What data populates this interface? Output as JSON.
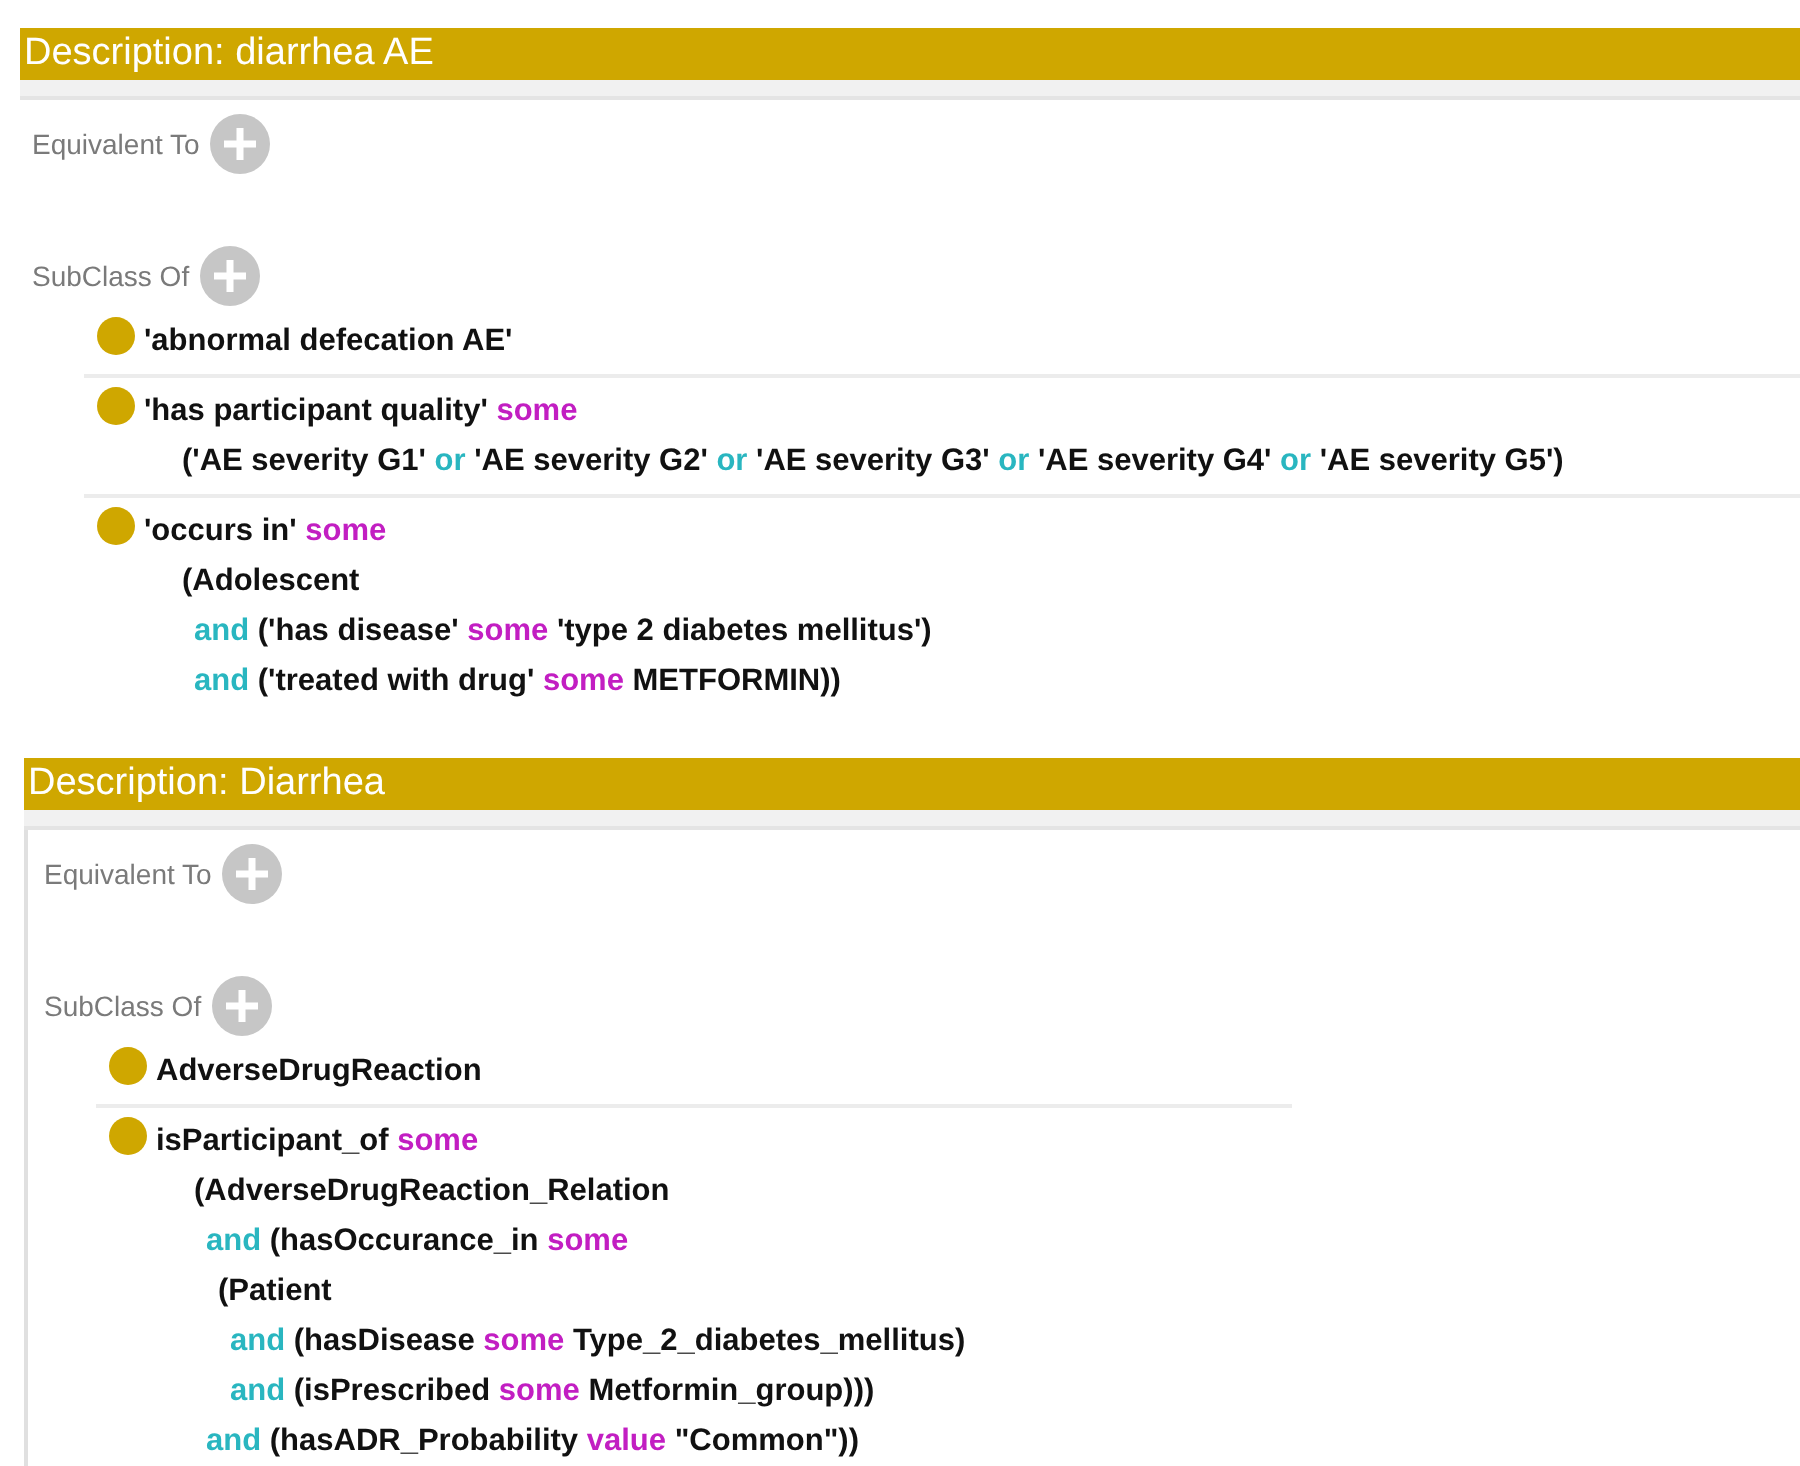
{
  "panels": [
    {
      "title": "Description: diarrhea AE",
      "sections": [
        {
          "label": "Equivalent To"
        },
        {
          "label": "SubClass Of",
          "items": [
            {
              "lines": [
                {
                  "tokens": [
                    {
                      "kind": "entity",
                      "text": "'abnormal defecation AE'"
                    }
                  ]
                }
              ]
            },
            {
              "lines": [
                {
                  "tokens": [
                    {
                      "kind": "entity",
                      "text": "'has participant quality'"
                    },
                    {
                      "kind": "restriction",
                      "text": "some"
                    }
                  ],
                  "children": [
                    {
                      "tokens": [
                        {
                          "kind": "entity",
                          "text": "('AE severity G1'"
                        },
                        {
                          "kind": "connective",
                          "text": "or"
                        },
                        {
                          "kind": "entity",
                          "text": "'AE severity G2'"
                        },
                        {
                          "kind": "connective",
                          "text": "or"
                        },
                        {
                          "kind": "entity",
                          "text": "'AE severity G3'"
                        },
                        {
                          "kind": "connective",
                          "text": "or"
                        },
                        {
                          "kind": "entity",
                          "text": "'AE severity G4'"
                        },
                        {
                          "kind": "connective",
                          "text": "or"
                        },
                        {
                          "kind": "entity",
                          "text": "'AE severity G5')"
                        }
                      ]
                    }
                  ]
                }
              ]
            },
            {
              "lines": [
                {
                  "tokens": [
                    {
                      "kind": "entity",
                      "text": "'occurs in'"
                    },
                    {
                      "kind": "restriction",
                      "text": "some"
                    }
                  ],
                  "children": [
                    {
                      "tokens": [
                        {
                          "kind": "entity",
                          "text": "(Adolescent"
                        }
                      ],
                      "children": [
                        {
                          "tokens": [
                            {
                              "kind": "connective",
                              "text": "and"
                            },
                            {
                              "kind": "entity",
                              "text": "('has disease'"
                            },
                            {
                              "kind": "restriction",
                              "text": "some"
                            },
                            {
                              "kind": "entity",
                              "text": "'type 2 diabetes mellitus')"
                            }
                          ]
                        },
                        {
                          "tokens": [
                            {
                              "kind": "connective",
                              "text": "and"
                            },
                            {
                              "kind": "entity",
                              "text": "('treated with drug'"
                            },
                            {
                              "kind": "restriction",
                              "text": "some"
                            },
                            {
                              "kind": "entity",
                              "text": "METFORMIN))"
                            }
                          ]
                        }
                      ]
                    }
                  ]
                }
              ]
            }
          ]
        }
      ]
    },
    {
      "title": "Description: Diarrhea",
      "sections": [
        {
          "label": "Equivalent To"
        },
        {
          "label": "SubClass Of",
          "items": [
            {
              "lines": [
                {
                  "tokens": [
                    {
                      "kind": "entity",
                      "text": "AdverseDrugReaction"
                    }
                  ]
                }
              ]
            },
            {
              "lines": [
                {
                  "tokens": [
                    {
                      "kind": "entity",
                      "text": "isParticipant_of"
                    },
                    {
                      "kind": "restriction",
                      "text": "some"
                    }
                  ],
                  "children": [
                    {
                      "tokens": [
                        {
                          "kind": "entity",
                          "text": "(AdverseDrugReaction_Relation"
                        }
                      ],
                      "children": [
                        {
                          "tokens": [
                            {
                              "kind": "connective",
                              "text": "and"
                            },
                            {
                              "kind": "entity",
                              "text": "(hasOccurance_in"
                            },
                            {
                              "kind": "restriction",
                              "text": "some"
                            }
                          ],
                          "children": [
                            {
                              "tokens": [
                                {
                                  "kind": "entity",
                                  "text": "(Patient"
                                }
                              ],
                              "children": [
                                {
                                  "tokens": [
                                    {
                                      "kind": "connective",
                                      "text": "and"
                                    },
                                    {
                                      "kind": "entity",
                                      "text": "(hasDisease"
                                    },
                                    {
                                      "kind": "restriction",
                                      "text": "some"
                                    },
                                    {
                                      "kind": "entity",
                                      "text": "Type_2_diabetes_mellitus)"
                                    }
                                  ]
                                },
                                {
                                  "tokens": [
                                    {
                                      "kind": "connective",
                                      "text": "and"
                                    },
                                    {
                                      "kind": "entity",
                                      "text": "(isPrescribed"
                                    },
                                    {
                                      "kind": "restriction",
                                      "text": "some"
                                    },
                                    {
                                      "kind": "entity",
                                      "text": "Metformin_group)))"
                                    }
                                  ]
                                }
                              ]
                            }
                          ]
                        },
                        {
                          "tokens": [
                            {
                              "kind": "connective",
                              "text": "and"
                            },
                            {
                              "kind": "entity",
                              "text": "(hasADR_Probability"
                            },
                            {
                              "kind": "restriction",
                              "text": "value"
                            },
                            {
                              "kind": "entity",
                              "text": "\"Common\"))"
                            }
                          ]
                        }
                      ]
                    }
                  ]
                }
              ]
            }
          ]
        }
      ]
    }
  ]
}
